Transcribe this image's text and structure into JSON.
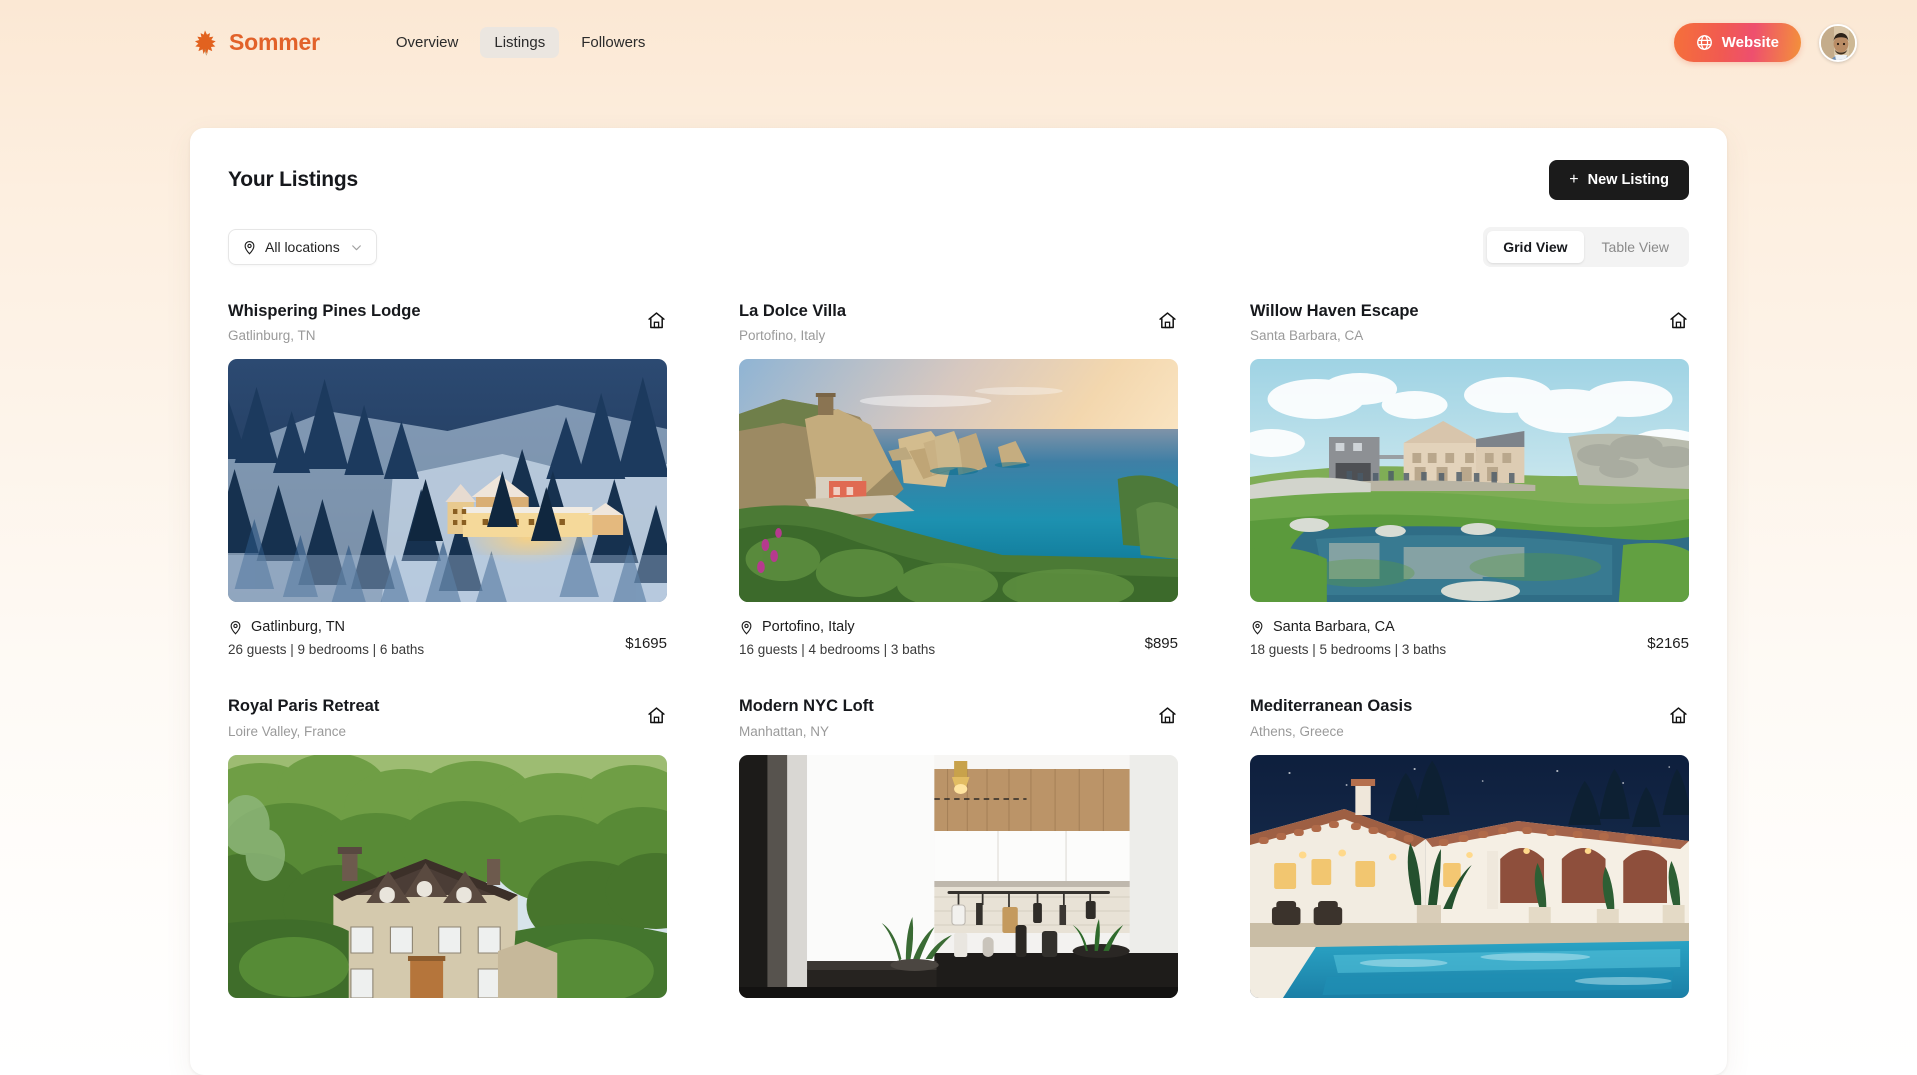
{
  "header": {
    "brand": "Sommer",
    "brand_color": "#e2622a",
    "logo_icon": "maple-leaf-icon",
    "nav": [
      {
        "label": "Overview",
        "active": false
      },
      {
        "label": "Listings",
        "active": true
      },
      {
        "label": "Followers",
        "active": false
      }
    ],
    "website_button": {
      "label": "Website",
      "icon": "globe-icon",
      "gradient_from": "#f5703a",
      "gradient_to": "#ee4f6e"
    },
    "avatar": {
      "icon": "user-avatar",
      "alt": "profile photo"
    }
  },
  "panel": {
    "title": "Your Listings",
    "new_listing_button": {
      "label": "New Listing",
      "icon": "plus-icon"
    },
    "location_filter": {
      "label": "All locations",
      "icon": "location-pin-icon",
      "chevron": "chevron-down-icon"
    },
    "view_toggle": {
      "options": [
        {
          "label": "Grid View",
          "selected": true
        },
        {
          "label": "Table View",
          "selected": false
        }
      ]
    }
  },
  "listings": [
    {
      "name": "Whispering Pines Lodge",
      "subtitle": "Gatlinburg, TN",
      "location": "Gatlinburg, TN",
      "guests": "26 guests",
      "bedrooms": "9 bedrooms",
      "baths": "6 baths",
      "meta": "26 guests | 9 bedrooms | 6 baths",
      "price": "$1695",
      "photo": "snowy-forest-lodge",
      "card_icon": "home-icon"
    },
    {
      "name": "La Dolce Villa",
      "subtitle": "Portofino, Italy",
      "location": "Portofino, Italy",
      "guests": "16 guests",
      "bedrooms": "4 bedrooms",
      "baths": "3 baths",
      "meta": "16 guests | 4 bedrooms | 3 baths",
      "price": "$895",
      "photo": "coastal-cliffs-sunset",
      "card_icon": "home-icon"
    },
    {
      "name": "Willow Haven Escape",
      "subtitle": "Santa Barbara, CA",
      "location": "Santa Barbara, CA",
      "guests": "18 guests",
      "bedrooms": "5 bedrooms",
      "baths": "3 baths",
      "meta": "18 guests | 5 bedrooms | 3 baths",
      "price": "$2165",
      "photo": "green-hill-lake-house",
      "card_icon": "home-icon"
    },
    {
      "name": "Royal Paris Retreat",
      "subtitle": "Loire Valley, France",
      "location": "Loire Valley, France",
      "meta": "",
      "price": "",
      "photo": "country-manor-trees",
      "card_icon": "home-icon"
    },
    {
      "name": "Modern NYC Loft",
      "subtitle": "Manhattan, NY",
      "location": "Manhattan, NY",
      "meta": "",
      "price": "",
      "photo": "modern-kitchen-loft",
      "card_icon": "home-icon"
    },
    {
      "name": "Mediterranean Oasis",
      "subtitle": "Athens, Greece",
      "location": "Athens, Greece",
      "meta": "",
      "price": "",
      "photo": "villa-pool-night",
      "card_icon": "home-icon"
    }
  ]
}
